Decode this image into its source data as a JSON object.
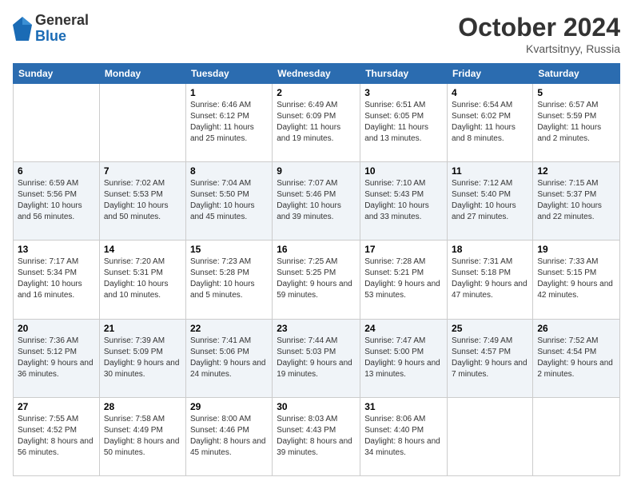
{
  "logo": {
    "general": "General",
    "blue": "Blue"
  },
  "header": {
    "month": "October 2024",
    "location": "Kvartsitnyy, Russia"
  },
  "weekdays": [
    "Sunday",
    "Monday",
    "Tuesday",
    "Wednesday",
    "Thursday",
    "Friday",
    "Saturday"
  ],
  "weeks": [
    [
      {
        "day": "",
        "info": ""
      },
      {
        "day": "",
        "info": ""
      },
      {
        "day": "1",
        "info": "Sunrise: 6:46 AM\nSunset: 6:12 PM\nDaylight: 11 hours and 25 minutes."
      },
      {
        "day": "2",
        "info": "Sunrise: 6:49 AM\nSunset: 6:09 PM\nDaylight: 11 hours and 19 minutes."
      },
      {
        "day": "3",
        "info": "Sunrise: 6:51 AM\nSunset: 6:05 PM\nDaylight: 11 hours and 13 minutes."
      },
      {
        "day": "4",
        "info": "Sunrise: 6:54 AM\nSunset: 6:02 PM\nDaylight: 11 hours and 8 minutes."
      },
      {
        "day": "5",
        "info": "Sunrise: 6:57 AM\nSunset: 5:59 PM\nDaylight: 11 hours and 2 minutes."
      }
    ],
    [
      {
        "day": "6",
        "info": "Sunrise: 6:59 AM\nSunset: 5:56 PM\nDaylight: 10 hours and 56 minutes."
      },
      {
        "day": "7",
        "info": "Sunrise: 7:02 AM\nSunset: 5:53 PM\nDaylight: 10 hours and 50 minutes."
      },
      {
        "day": "8",
        "info": "Sunrise: 7:04 AM\nSunset: 5:50 PM\nDaylight: 10 hours and 45 minutes."
      },
      {
        "day": "9",
        "info": "Sunrise: 7:07 AM\nSunset: 5:46 PM\nDaylight: 10 hours and 39 minutes."
      },
      {
        "day": "10",
        "info": "Sunrise: 7:10 AM\nSunset: 5:43 PM\nDaylight: 10 hours and 33 minutes."
      },
      {
        "day": "11",
        "info": "Sunrise: 7:12 AM\nSunset: 5:40 PM\nDaylight: 10 hours and 27 minutes."
      },
      {
        "day": "12",
        "info": "Sunrise: 7:15 AM\nSunset: 5:37 PM\nDaylight: 10 hours and 22 minutes."
      }
    ],
    [
      {
        "day": "13",
        "info": "Sunrise: 7:17 AM\nSunset: 5:34 PM\nDaylight: 10 hours and 16 minutes."
      },
      {
        "day": "14",
        "info": "Sunrise: 7:20 AM\nSunset: 5:31 PM\nDaylight: 10 hours and 10 minutes."
      },
      {
        "day": "15",
        "info": "Sunrise: 7:23 AM\nSunset: 5:28 PM\nDaylight: 10 hours and 5 minutes."
      },
      {
        "day": "16",
        "info": "Sunrise: 7:25 AM\nSunset: 5:25 PM\nDaylight: 9 hours and 59 minutes."
      },
      {
        "day": "17",
        "info": "Sunrise: 7:28 AM\nSunset: 5:21 PM\nDaylight: 9 hours and 53 minutes."
      },
      {
        "day": "18",
        "info": "Sunrise: 7:31 AM\nSunset: 5:18 PM\nDaylight: 9 hours and 47 minutes."
      },
      {
        "day": "19",
        "info": "Sunrise: 7:33 AM\nSunset: 5:15 PM\nDaylight: 9 hours and 42 minutes."
      }
    ],
    [
      {
        "day": "20",
        "info": "Sunrise: 7:36 AM\nSunset: 5:12 PM\nDaylight: 9 hours and 36 minutes."
      },
      {
        "day": "21",
        "info": "Sunrise: 7:39 AM\nSunset: 5:09 PM\nDaylight: 9 hours and 30 minutes."
      },
      {
        "day": "22",
        "info": "Sunrise: 7:41 AM\nSunset: 5:06 PM\nDaylight: 9 hours and 24 minutes."
      },
      {
        "day": "23",
        "info": "Sunrise: 7:44 AM\nSunset: 5:03 PM\nDaylight: 9 hours and 19 minutes."
      },
      {
        "day": "24",
        "info": "Sunrise: 7:47 AM\nSunset: 5:00 PM\nDaylight: 9 hours and 13 minutes."
      },
      {
        "day": "25",
        "info": "Sunrise: 7:49 AM\nSunset: 4:57 PM\nDaylight: 9 hours and 7 minutes."
      },
      {
        "day": "26",
        "info": "Sunrise: 7:52 AM\nSunset: 4:54 PM\nDaylight: 9 hours and 2 minutes."
      }
    ],
    [
      {
        "day": "27",
        "info": "Sunrise: 7:55 AM\nSunset: 4:52 PM\nDaylight: 8 hours and 56 minutes."
      },
      {
        "day": "28",
        "info": "Sunrise: 7:58 AM\nSunset: 4:49 PM\nDaylight: 8 hours and 50 minutes."
      },
      {
        "day": "29",
        "info": "Sunrise: 8:00 AM\nSunset: 4:46 PM\nDaylight: 8 hours and 45 minutes."
      },
      {
        "day": "30",
        "info": "Sunrise: 8:03 AM\nSunset: 4:43 PM\nDaylight: 8 hours and 39 minutes."
      },
      {
        "day": "31",
        "info": "Sunrise: 8:06 AM\nSunset: 4:40 PM\nDaylight: 8 hours and 34 minutes."
      },
      {
        "day": "",
        "info": ""
      },
      {
        "day": "",
        "info": ""
      }
    ]
  ],
  "row_styles": [
    "row-white",
    "row-alt",
    "row-white",
    "row-alt",
    "row-white"
  ]
}
